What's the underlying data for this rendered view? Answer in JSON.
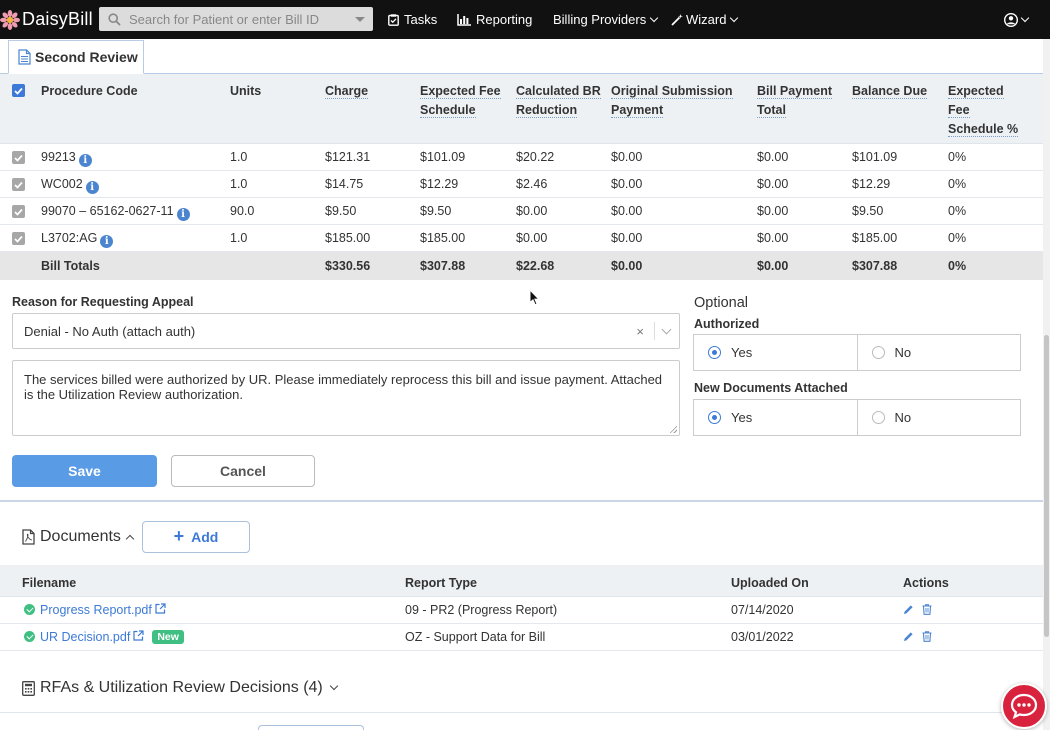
{
  "nav": {
    "brand": "DaisyBill",
    "search_placeholder": "Search for Patient or enter Bill ID",
    "tasks": "Tasks",
    "reporting": "Reporting",
    "billing_providers": "Billing Providers",
    "wizard": "Wizard"
  },
  "tab": {
    "label": "Second Review"
  },
  "procedures": {
    "headers": [
      "Procedure Code",
      "Units",
      "Charge",
      "Expected Fee Schedule",
      "Calculated BR Reduction",
      "Original Submission Payment",
      "Bill Payment Total",
      "Balance Due",
      "Expected Fee Schedule %"
    ],
    "rows": [
      {
        "code": "99213",
        "units": "1.0",
        "charge": "$121.31",
        "expected": "$101.09",
        "br": "$20.22",
        "orig": "$0.00",
        "paid": "$0.00",
        "balance": "$101.09",
        "pct": "0%"
      },
      {
        "code": "WC002",
        "units": "1.0",
        "charge": "$14.75",
        "expected": "$12.29",
        "br": "$2.46",
        "orig": "$0.00",
        "paid": "$0.00",
        "balance": "$12.29",
        "pct": "0%"
      },
      {
        "code": "99070 – 65162-0627-11",
        "units": "90.0",
        "charge": "$9.50",
        "expected": "$9.50",
        "br": "$0.00",
        "orig": "$0.00",
        "paid": "$0.00",
        "balance": "$9.50",
        "pct": "0%"
      },
      {
        "code": "L3702:AG",
        "units": "1.0",
        "charge": "$185.00",
        "expected": "$185.00",
        "br": "$0.00",
        "orig": "$0.00",
        "paid": "$0.00",
        "balance": "$185.00",
        "pct": "0%"
      }
    ],
    "totals": {
      "label": "Bill Totals",
      "charge": "$330.56",
      "expected": "$307.88",
      "br": "$22.68",
      "orig": "$0.00",
      "paid": "$0.00",
      "balance": "$307.88",
      "pct": "0%"
    }
  },
  "appeal": {
    "reason_label": "Reason for Requesting Appeal",
    "reason_value": "Denial - No Auth (attach auth)",
    "clear_glyph": "×",
    "message": "The services billed were authorized by UR. Please immediately reprocess this bill and issue payment. Attached is the Utilization Review authorization.",
    "optional": "Optional",
    "authorized_label": "Authorized",
    "new_docs_label": "New Documents Attached",
    "yes": "Yes",
    "no": "No",
    "authorized_value": "Yes",
    "new_docs_value": "Yes",
    "save": "Save",
    "cancel": "Cancel"
  },
  "documents": {
    "title": "Documents",
    "add": "Add",
    "headers": [
      "Filename",
      "Report Type",
      "Uploaded On",
      "Actions"
    ],
    "rows": [
      {
        "filename": "Progress Report.pdf",
        "report_type": "09 - PR2 (Progress Report)",
        "uploaded": "07/14/2020",
        "badge": ""
      },
      {
        "filename": "UR Decision.pdf",
        "report_type": "OZ - Support Data for Bill",
        "uploaded": "03/01/2022",
        "badge": "New"
      }
    ]
  },
  "rfa": {
    "title": "RFAs & Utilization Review Decisions (4)"
  },
  "colors": {
    "nav_bg": "#111111",
    "accent": "#3d7ad8",
    "save_bg": "#5a9be5",
    "success": "#3fbf82",
    "chat": "#d9233e"
  }
}
